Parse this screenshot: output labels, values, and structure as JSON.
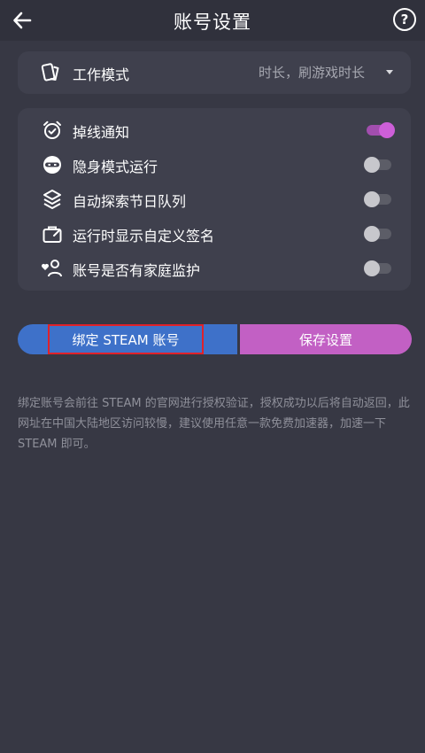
{
  "header": {
    "title": "账号设置",
    "back_icon": "arrow-left-icon",
    "help_icon": "question-circle-icon",
    "help_glyph": "?"
  },
  "work_mode": {
    "label": "工作模式",
    "value": "时长，刷游戏时长",
    "icon": "cards-icon"
  },
  "toggles": [
    {
      "label": "掉线通知",
      "icon": "alarm-clock-icon",
      "on": true
    },
    {
      "label": "隐身模式运行",
      "icon": "ninja-icon",
      "on": false
    },
    {
      "label": "自动探索节日队列",
      "icon": "layers-icon",
      "on": false
    },
    {
      "label": "运行时显示自定义签名",
      "icon": "suitcase-icon",
      "on": false
    },
    {
      "label": "账号是否有家庭监护",
      "icon": "family-user-icon",
      "on": false
    }
  ],
  "actions": {
    "bind_label": "绑定 STEAM 账号",
    "save_label": "保存设置"
  },
  "note": "绑定账号会前往 STEAM 的官网进行授权验证，授权成功以后将自动返回，此网址在中国大陆地区访问较慢，建议使用任意一款免费加速器，加速一下 STEAM 即可。",
  "colors": {
    "background": "#373844",
    "card": "#3f404d",
    "toggle_on": "#cd5fd8",
    "bind_button": "#3e71c9",
    "save_button": "#c260c4",
    "highlight_border": "#e0222a"
  }
}
